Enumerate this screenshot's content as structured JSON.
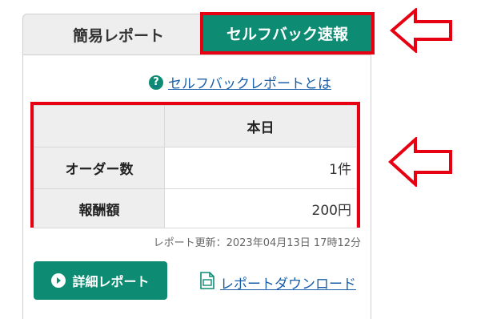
{
  "tabs": {
    "simple_report": "簡易レポート",
    "selfback_news": "セルフバック速報"
  },
  "help_link": {
    "icon": "question-circle-icon",
    "label": "セルフバックレポートとは"
  },
  "report_table": {
    "column_header": "本日",
    "rows": [
      {
        "label": "オーダー数",
        "value": "1件"
      },
      {
        "label": "報酬額",
        "value": "200円"
      }
    ]
  },
  "updated_text": "レポート更新：2023年04月13日 17時12分",
  "detail_button": {
    "icon": "play-circle-icon",
    "label": "詳細レポート"
  },
  "download_link": {
    "icon": "csv-file-icon",
    "label": "レポートダウンロード"
  },
  "colors": {
    "accent_green": "#0e8b73",
    "highlight_red": "#e60012",
    "link_blue": "#1a5fa8"
  }
}
